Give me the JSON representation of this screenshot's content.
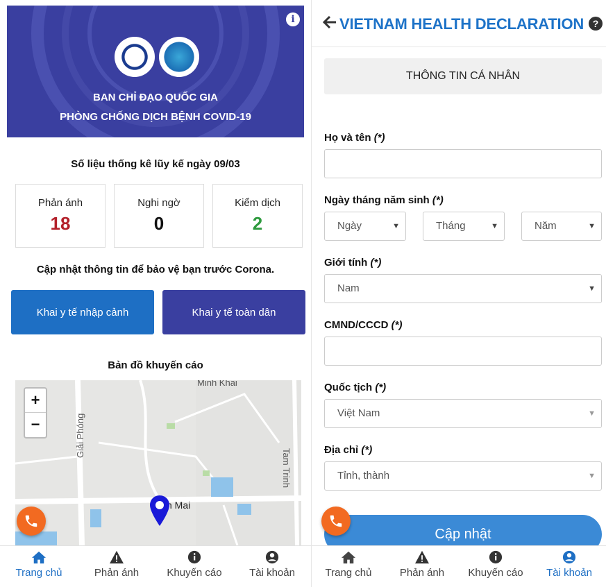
{
  "left": {
    "banner": {
      "line1": "BAN CHỈ ĐẠO QUỐC GIA",
      "line2": "PHÒNG CHỐNG DỊCH BỆNH COVID-19",
      "info_icon": "info-icon"
    },
    "stats_title": "Số liệu thống kê lũy kế ngày 09/03",
    "stats": [
      {
        "label": "Phản ánh",
        "value": "18",
        "color": "#b3202a"
      },
      {
        "label": "Nghi ngờ",
        "value": "0",
        "color": "#111111"
      },
      {
        "label": "Kiểm dịch",
        "value": "2",
        "color": "#2e9a3e"
      }
    ],
    "update_note": "Cập nhật thông tin để bảo vệ bạn trước Corona.",
    "buttons": {
      "entry": "Khai y tế nhập cảnh",
      "all": "Khai y tế toàn dân"
    },
    "map": {
      "title": "Bản đồ khuyến cáo",
      "zoom_in": "+",
      "zoom_out": "−",
      "labels": [
        "Minh Khai",
        "Giải Phóng",
        "Tam Trinh",
        "n Mai"
      ]
    }
  },
  "right": {
    "header_title": "VIETNAM HEALTH DECLARATION",
    "section_title": "THÔNG TIN CÁ NHÂN",
    "fields": {
      "name": "Họ và tên",
      "dob": "Ngày tháng năm sinh",
      "gender": "Giới tính",
      "id": "CMND/CCCD",
      "nationality": "Quốc tịch",
      "address": "Địa chỉ",
      "required": "(*)"
    },
    "dob": {
      "day": "Ngày",
      "month": "Tháng",
      "year": "Năm"
    },
    "gender_value": "Nam",
    "nationality_value": "Việt Nam",
    "address_value": "Tỉnh, thành",
    "submit": "Cập nhật"
  },
  "nav": {
    "home": "Trang chủ",
    "report": "Phản ánh",
    "advice": "Khuyến cáo",
    "account": "Tài khoản"
  },
  "colors": {
    "banner": "#3a3fa0",
    "primary_blue": "#1e6fc4",
    "accent_blue": "#1e73c8",
    "indigo": "#3a3fa0",
    "fab_orange": "#f26a21",
    "submit_blue": "#3b8ad6"
  }
}
